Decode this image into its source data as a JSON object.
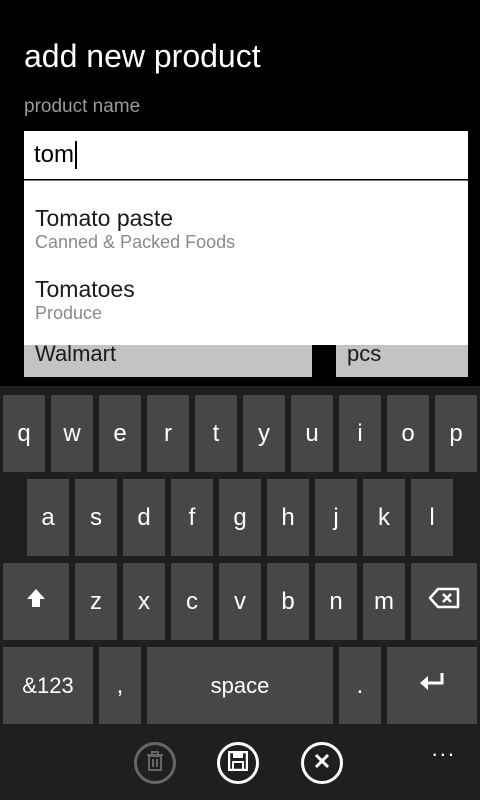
{
  "page": {
    "title": "add new product",
    "field_label": "product name"
  },
  "input": {
    "value": "tom"
  },
  "suggestions": [
    {
      "name": "Tomato paste",
      "category": "Canned & Packed Foods"
    },
    {
      "name": "Tomatoes",
      "category": "Produce"
    }
  ],
  "background_fields": {
    "store": "Walmart",
    "unit": "pcs"
  },
  "keyboard": {
    "row1": [
      "q",
      "w",
      "e",
      "r",
      "t",
      "y",
      "u",
      "i",
      "o",
      "p"
    ],
    "row2": [
      "a",
      "s",
      "d",
      "f",
      "g",
      "h",
      "j",
      "k",
      "l"
    ],
    "row3": [
      "z",
      "x",
      "c",
      "v",
      "b",
      "n",
      "m"
    ],
    "bottom": {
      "symbols": "&123",
      "comma": ",",
      "space": "space",
      "period": "."
    },
    "icons": {
      "shift": "shift-arrow-icon",
      "backspace": "backspace-icon",
      "enter": "enter-icon"
    }
  },
  "appbar": {
    "icons": [
      "delete-icon",
      "save-icon",
      "cancel-icon"
    ],
    "more": "..."
  },
  "colors": {
    "background": "#000000",
    "keyboard": "#1f1f1f",
    "key": "#474747",
    "input": "#ffffff"
  }
}
